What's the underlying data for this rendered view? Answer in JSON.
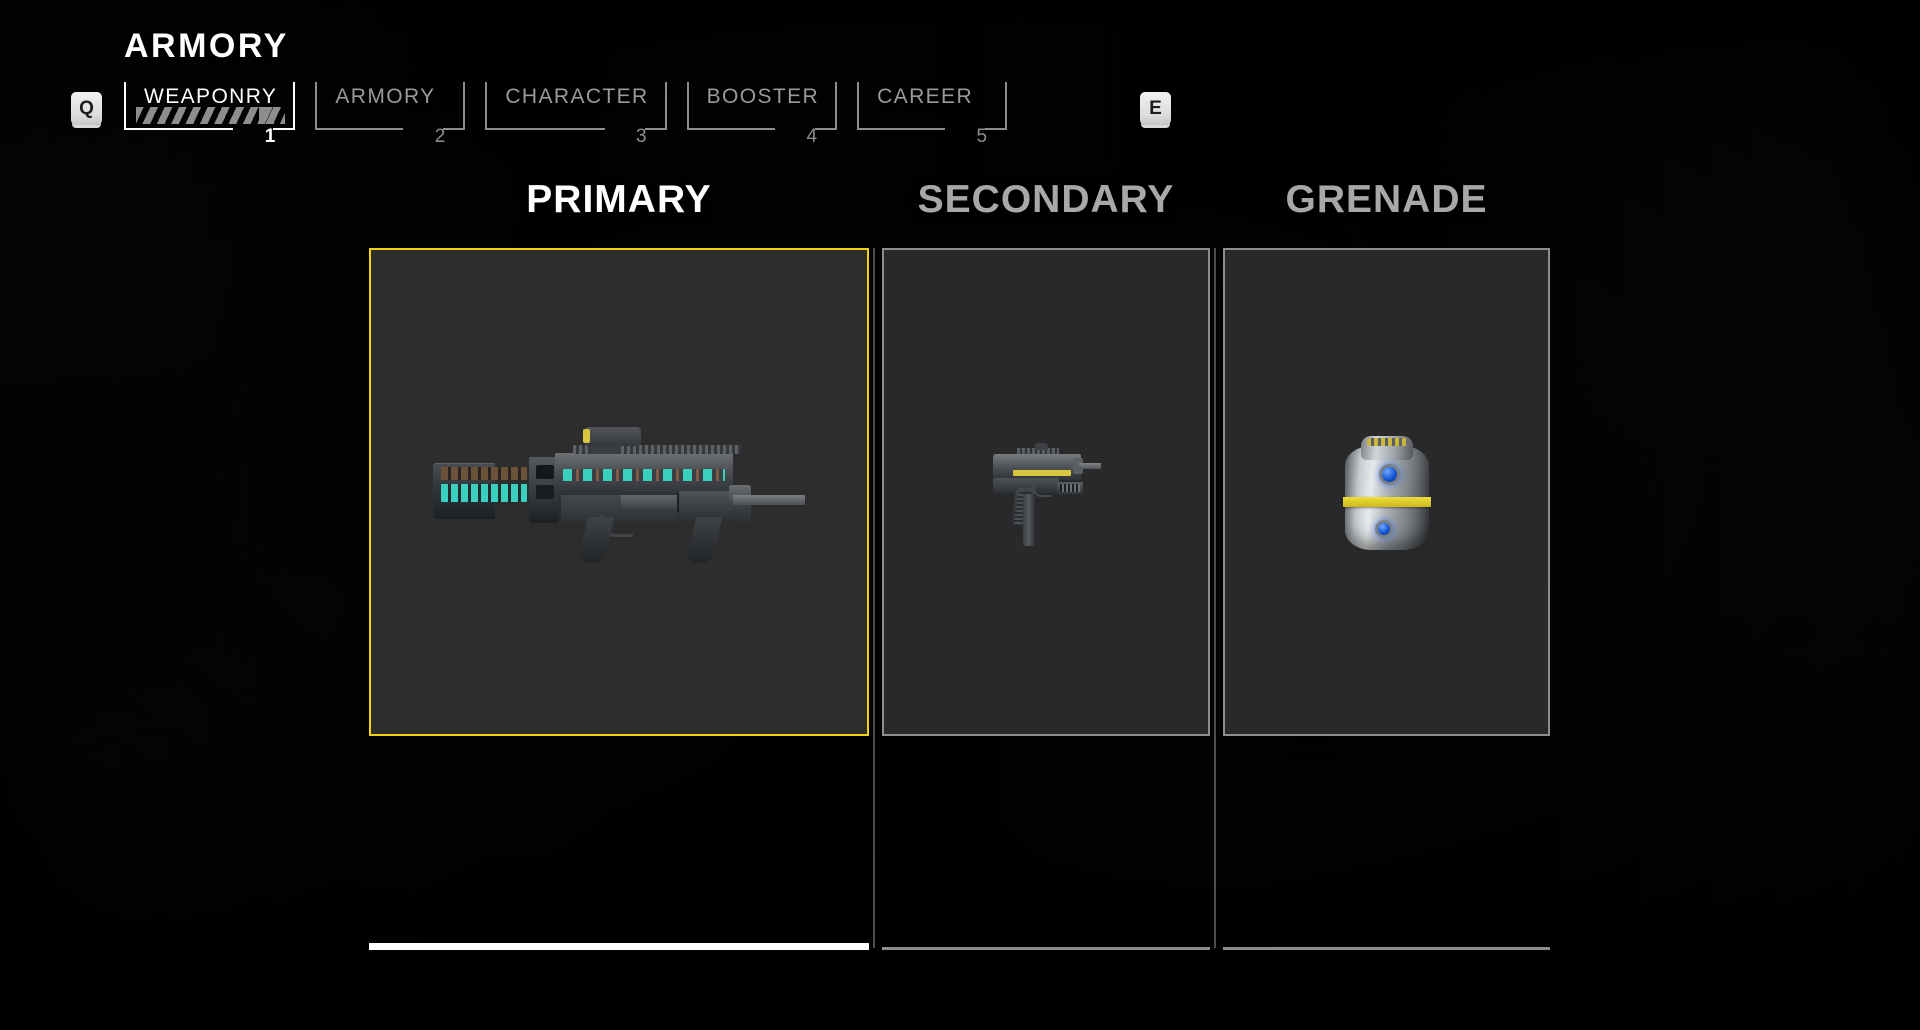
{
  "header": {
    "title": "ARMORY",
    "left_key": "Q",
    "right_key": "E",
    "tabs": [
      {
        "label": "WEAPONRY",
        "number": "1",
        "active": true
      },
      {
        "label": "ARMORY",
        "number": "2",
        "active": false
      },
      {
        "label": "CHARACTER",
        "number": "3",
        "active": false
      },
      {
        "label": "BOOSTER",
        "number": "4",
        "active": false
      },
      {
        "label": "CAREER",
        "number": "5",
        "active": false
      }
    ]
  },
  "loadout": {
    "columns": [
      {
        "title": "PRIMARY",
        "selected": true,
        "item": "energy-assault-rifle",
        "border_color": "#f2d413",
        "underline_color": "#ffffff"
      },
      {
        "title": "SECONDARY",
        "selected": false,
        "item": "machine-pistol",
        "border_color": "#8d8d8d",
        "underline_color": "#8d8d8d"
      },
      {
        "title": "GRENADE",
        "selected": false,
        "item": "frag-grenade",
        "border_color": "#8d8d8d",
        "underline_color": "#8d8d8d"
      }
    ]
  },
  "colors": {
    "accent_selected": "#f2d413",
    "text_active": "#ffffff",
    "text_inactive": "#a8a8a8",
    "frame_inactive": "#8d8d8d",
    "card_fill": "#2c2c2c",
    "background": "#050505",
    "weapon_energy_cell": "#3ad0c0",
    "grenade_band": "#f0dd3a",
    "grenade_led": "#1556d6"
  }
}
